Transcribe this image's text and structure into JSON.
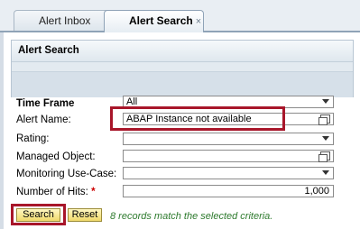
{
  "tabs": [
    {
      "label": "Alert Inbox"
    },
    {
      "label": "Alert Search",
      "close_glyph": "×"
    }
  ],
  "panel": {
    "title": "Alert Search"
  },
  "form": {
    "time_frame": {
      "label": "Time Frame",
      "value": "All"
    },
    "alert_name": {
      "label": "Alert Name:",
      "value": "ABAP Instance not available"
    },
    "rating": {
      "label": "Rating:",
      "value": ""
    },
    "managed_object": {
      "label": "Managed Object:",
      "value": ""
    },
    "monitoring_use_case": {
      "label": "Monitoring Use-Case:",
      "value": ""
    },
    "number_of_hits": {
      "label": "Number of Hits:",
      "required_mark": "*",
      "value": "1,000"
    }
  },
  "buttons": {
    "search": "Search",
    "reset": "Reset"
  },
  "status_message": "8 records match the selected criteria.",
  "colors": {
    "highlight": "#a8162a",
    "status_text": "#2d7a2d",
    "button_bg": "#f0d96a"
  }
}
